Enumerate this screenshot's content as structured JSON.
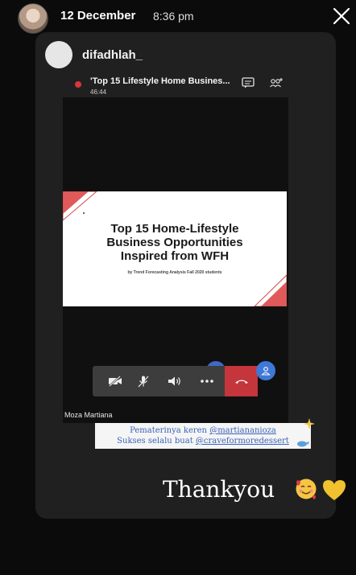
{
  "header": {
    "date": "12 December",
    "time": "8:36 pm"
  },
  "story": {
    "username": "difadhlah_"
  },
  "meeting": {
    "title": "'Top 15 Lifestyle Home Busines...",
    "duration": "46:44",
    "participant_name": "Moza Martiana"
  },
  "slide": {
    "title_line1": "Top 15 Home-Lifestyle",
    "title_line2": "Business Opportunities",
    "title_line3": "Inspired from WFH",
    "subtitle": "by Trend Forecasting Analysis Fall 2020 students"
  },
  "caption": {
    "line1_prefix": "Pematerinya keren ",
    "line1_mention": "@martiananioza",
    "line2_prefix": "Sukses selalu buat ",
    "line2_mention": "@craveformoredessert"
  },
  "thanks_text": "Thankyou",
  "icons": {
    "close": "close-icon",
    "chat": "chat-icon",
    "people": "people-icon",
    "camera_off": "camera-off-icon",
    "mic_off": "mic-off-icon",
    "speaker": "speaker-icon",
    "more": "more-icon",
    "end_call": "end-call-icon",
    "profile": "profile-icon"
  },
  "colors": {
    "end_call": "#c4353c",
    "caption_text": "#3b63b7",
    "slide_accent": "#e05a5a"
  }
}
